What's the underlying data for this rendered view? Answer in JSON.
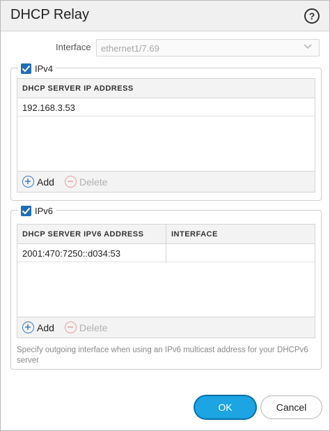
{
  "dialog": {
    "title": "DHCP Relay"
  },
  "interface": {
    "label": "Interface",
    "value": "ethernet1/7.69"
  },
  "ipv4": {
    "label": "IPv4",
    "checked": true,
    "columns": [
      "DHCP SERVER IP ADDRESS"
    ],
    "rows": [
      [
        "192.168.3.53"
      ]
    ],
    "add_label": "Add",
    "delete_label": "Delete"
  },
  "ipv6": {
    "label": "IPv6",
    "checked": true,
    "columns": [
      "DHCP SERVER IPV6 ADDRESS",
      "INTERFACE"
    ],
    "rows": [
      [
        "2001:470:7250::d034:53",
        ""
      ]
    ],
    "add_label": "Add",
    "delete_label": "Delete",
    "note": "Specify outgoing interface when using an IPv6 multicast address for your DHCPv6 server"
  },
  "buttons": {
    "ok_label": "OK",
    "cancel_label": "Cancel"
  },
  "icons": {
    "help": "help-icon",
    "chevron": "chevron-down-icon",
    "check": "check-icon",
    "add": "plus-circle-icon",
    "delete": "minus-circle-icon"
  },
  "colors": {
    "accent": "#1ca4e3",
    "checkbox": "#1f6fb5"
  }
}
